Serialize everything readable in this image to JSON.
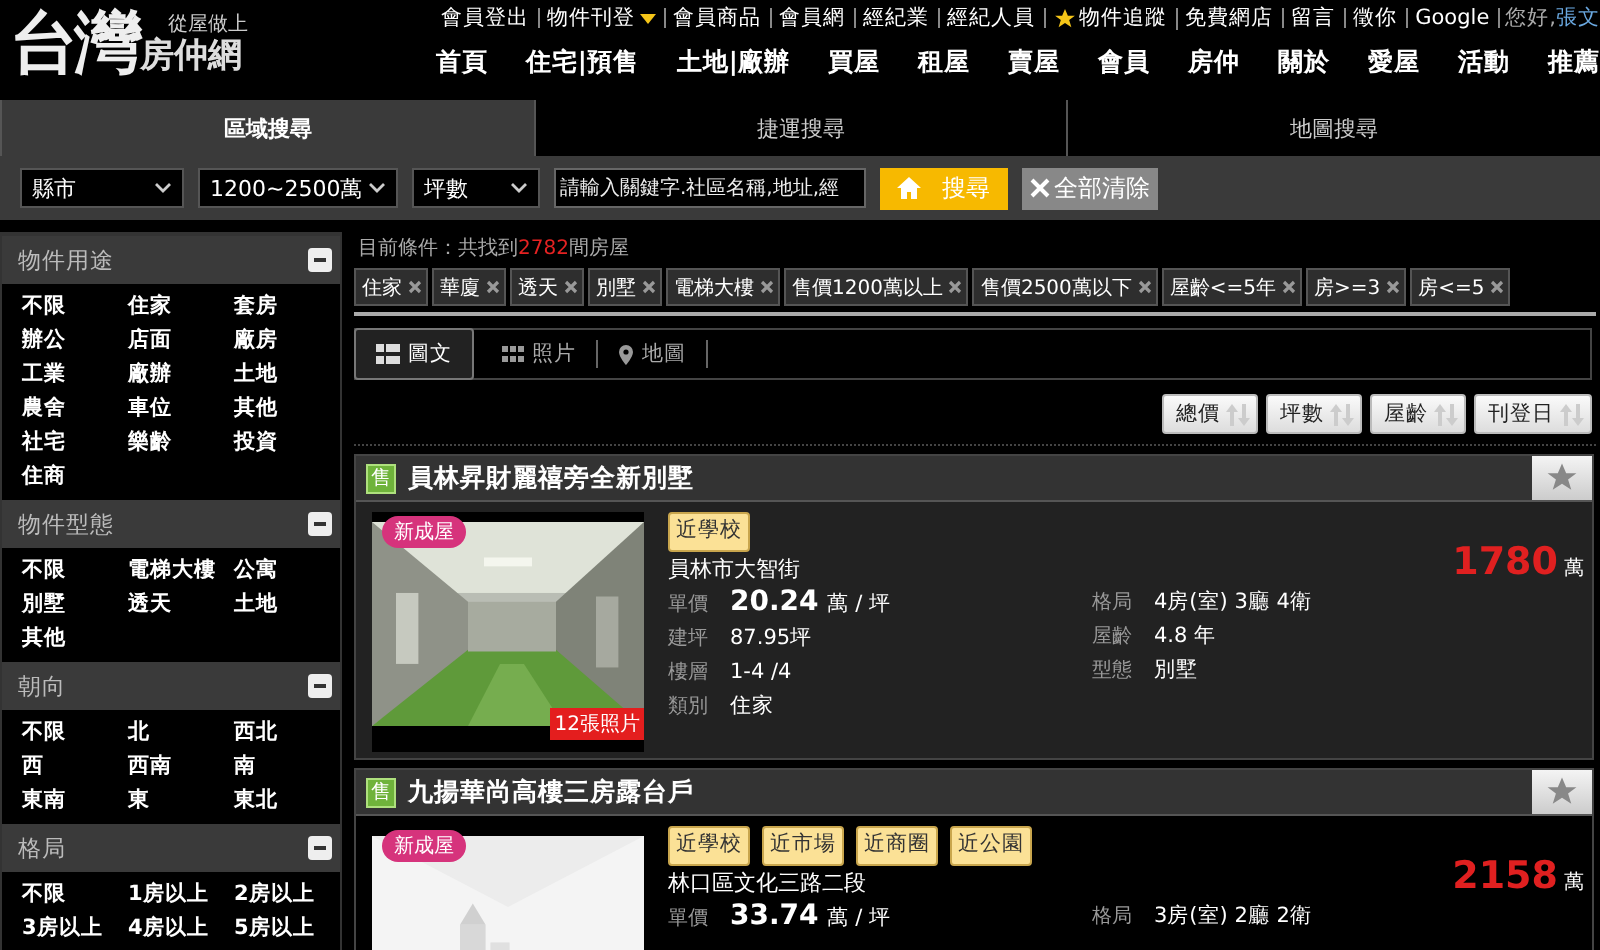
{
  "logo": {
    "main": "台灣",
    "sub": "房仲網",
    "slogan": "從屋做上"
  },
  "top_links": [
    {
      "label": "會員登出",
      "kind": "link"
    },
    {
      "label": "物件刊登",
      "kind": "dropdown"
    },
    {
      "label": "會員商品",
      "kind": "link"
    },
    {
      "label": "會員網",
      "kind": "link"
    },
    {
      "label": "經紀業",
      "kind": "link"
    },
    {
      "label": "經紀人員",
      "kind": "link"
    },
    {
      "label": "物件追蹤",
      "kind": "starred"
    },
    {
      "label": "免費網店",
      "kind": "link"
    },
    {
      "label": "留言",
      "kind": "link"
    },
    {
      "label": "徵你",
      "kind": "link"
    },
    {
      "label": "Google",
      "kind": "link"
    }
  ],
  "greeting": {
    "text": "您好,",
    "name": "張文"
  },
  "nav": [
    "首頁",
    "住宅|預售",
    "土地|廠辦",
    "買屋",
    "租屋",
    "賣屋",
    "會員",
    "房仲",
    "關於",
    "愛屋",
    "活動",
    "推薦"
  ],
  "search_tabs": [
    {
      "label": "區域搜尋",
      "selected": true
    },
    {
      "label": "捷運搜尋",
      "selected": false
    },
    {
      "label": "地圖搜尋",
      "selected": false
    }
  ],
  "filters": {
    "selects": [
      "縣市",
      "1200~2500萬",
      "坪數"
    ],
    "keyword_placeholder": "請輸入關鍵字.社區名稱,地址,經",
    "search_button": "搜尋",
    "clear_button": "全部清除"
  },
  "sidebar": [
    {
      "title": "物件用途",
      "items": [
        "不限",
        "住家",
        "套房",
        "辦公",
        "店面",
        "廠房",
        "工業",
        "廠辦",
        "土地",
        "農舍",
        "車位",
        "其他",
        "社宅",
        "樂齡",
        "投資",
        "住商"
      ]
    },
    {
      "title": "物件型態",
      "items": [
        "不限",
        "電梯大樓",
        "公寓",
        "別墅",
        "透天",
        "土地",
        "其他"
      ]
    },
    {
      "title": "朝向",
      "items": [
        "不限",
        "北",
        "西北",
        "西",
        "西南",
        "南",
        "東南",
        "東",
        "東北"
      ]
    },
    {
      "title": "格局",
      "items": [
        "不限",
        "1房以上",
        "2房以上",
        "3房以上",
        "4房以上",
        "5房以上"
      ]
    }
  ],
  "result": {
    "prefix": "目前條件：共找到",
    "count": "2782",
    "suffix": "間房屋"
  },
  "tags": [
    "住家",
    "華廈",
    "透天",
    "別墅",
    "電梯大樓",
    "售價1200萬以上",
    "售價2500萬以下",
    "屋齡<=5年",
    "房>=3",
    "房<=5"
  ],
  "view_tabs": [
    {
      "label": "圖文",
      "kind": "list",
      "selected": true
    },
    {
      "label": "照片",
      "kind": "photos",
      "selected": false
    },
    {
      "label": "地圖",
      "kind": "map",
      "selected": false
    }
  ],
  "sort_buttons": [
    "總價",
    "坪數",
    "屋齡",
    "刊登日"
  ],
  "listings": [
    {
      "badge": "售",
      "title": "員林昇財麗禧旁全新別墅",
      "highlighted": true,
      "photo_badge": "新成屋",
      "photo_count": "12張照片",
      "features": [
        "近學校"
      ],
      "address": "員林市大智街",
      "unit_price": {
        "label": "單價",
        "value": "20.24",
        "unit": "萬 / 坪"
      },
      "left": [
        {
          "label": "建坪",
          "value": "87.95坪"
        },
        {
          "label": "樓層",
          "value": "1-4 /4"
        },
        {
          "label": "類別",
          "value": "住家"
        }
      ],
      "right": [
        {
          "label": "格局",
          "value": "4房(室) 3廳 4衛"
        },
        {
          "label": "屋齡",
          "value": "4.8 年"
        },
        {
          "label": "型態",
          "value": "別墅"
        }
      ],
      "price": "1780",
      "price_unit": "萬"
    },
    {
      "badge": "售",
      "title": "九揚華尚高樓三房露台戶",
      "highlighted": false,
      "photo_badge": "新成屋",
      "features": [
        "近學校",
        "近市場",
        "近商圈",
        "近公園"
      ],
      "address": "林口區文化三路二段",
      "unit_price": {
        "label": "單價",
        "value": "33.74",
        "unit": "萬 / 坪"
      },
      "right": [
        {
          "label": "格局",
          "value": "3房(室) 2廳 2衛"
        }
      ],
      "price": "2158",
      "price_unit": "萬"
    }
  ]
}
